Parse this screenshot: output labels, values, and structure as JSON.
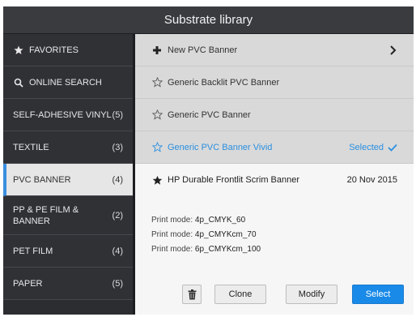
{
  "header": {
    "title": "Substrate library"
  },
  "sidebar": {
    "items": [
      {
        "label": "FAVORITES",
        "icon": "star-icon"
      },
      {
        "label": "ONLINE SEARCH",
        "icon": "search-icon"
      },
      {
        "label": "SELF-ADHESIVE VINYL",
        "count": "(5)"
      },
      {
        "label": "TEXTILE",
        "count": "(3)"
      },
      {
        "label": "PVC BANNER",
        "count": "(4)",
        "active": true
      },
      {
        "label": "PP & PE FILM &",
        "label2": "BANNER",
        "count": "(2)"
      },
      {
        "label": "PET FILM",
        "count": "(4)"
      },
      {
        "label": "PAPER",
        "count": "(5)"
      }
    ]
  },
  "main": {
    "new_item": {
      "label": "New PVC Banner"
    },
    "rows": [
      {
        "label": "Generic Backlit PVC Banner"
      },
      {
        "label": "Generic PVC Banner"
      },
      {
        "label": "Generic PVC Banner Vivid",
        "status": "Selected"
      },
      {
        "label": "HP Durable Frontlit Scrim Banner",
        "date": "20 Nov 2015"
      }
    ],
    "print_modes": [
      {
        "key": "Print mode:",
        "value": "4p_CMYK_60"
      },
      {
        "key": "Print mode:",
        "value": "4p_CMYKcm_70"
      },
      {
        "key": "Print mode:",
        "value": "6p_CMYKcm_100"
      }
    ],
    "buttons": {
      "clone": "Clone",
      "modify": "Modify",
      "select": "Select"
    }
  },
  "colors": {
    "accent": "#1a8ae8",
    "vivid_text": "#2a8fe0",
    "sidebar_bg": "#2b2d31"
  }
}
